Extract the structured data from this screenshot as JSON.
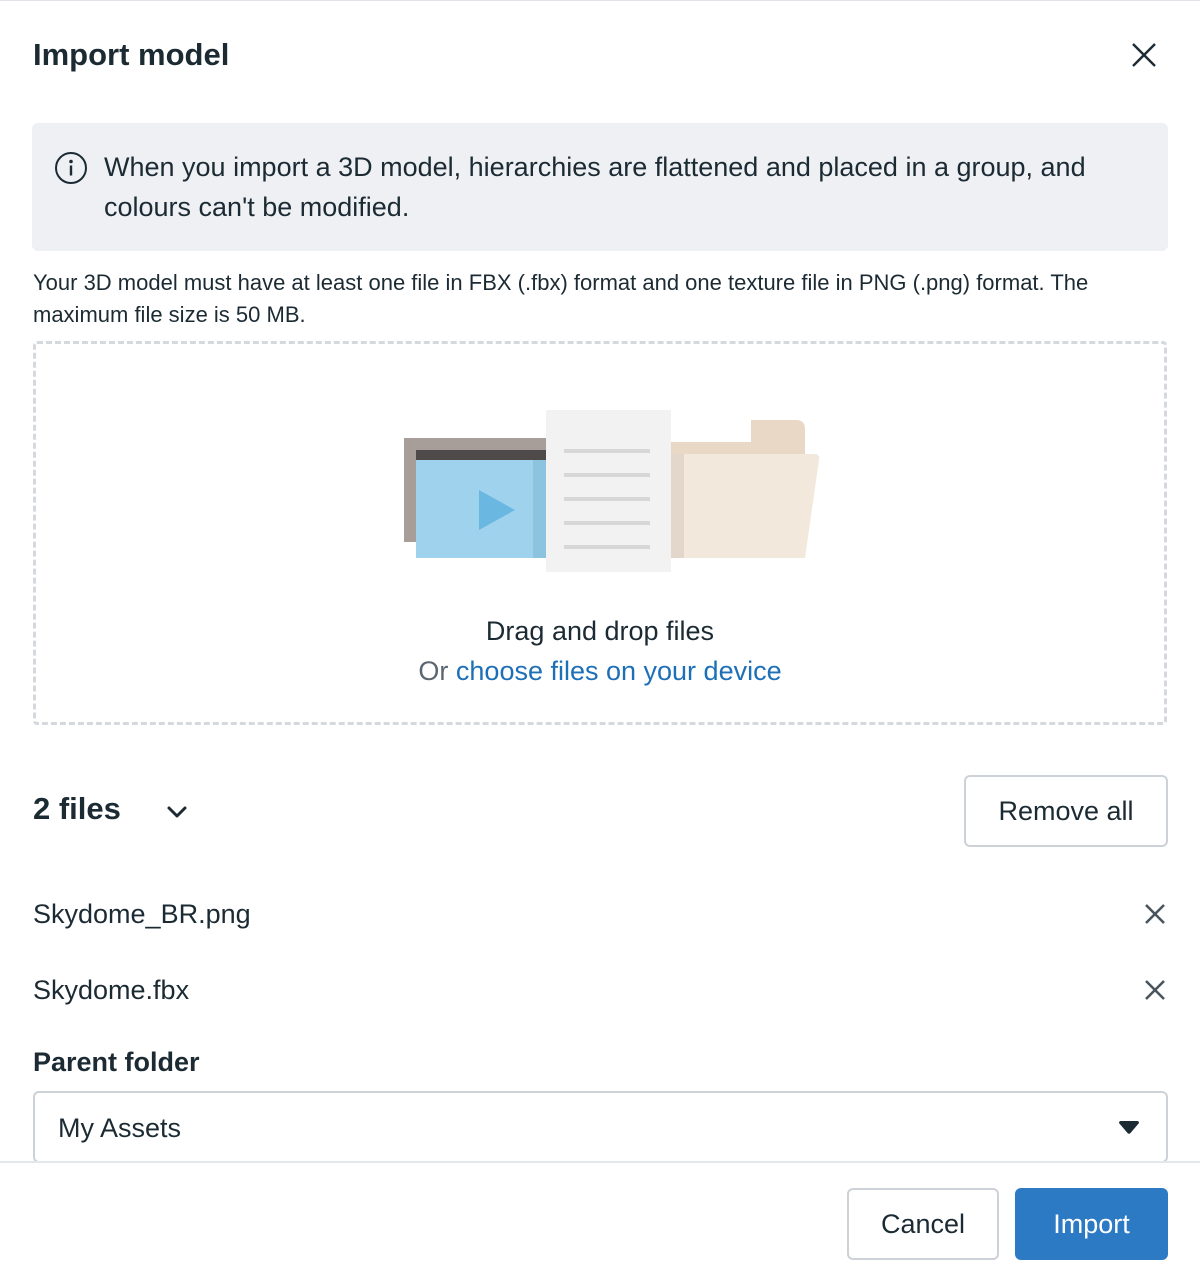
{
  "dialog": {
    "title": "Import model",
    "close_icon": "close-icon"
  },
  "info": {
    "icon": "info-icon",
    "text": "When you import a 3D model, hierarchies are flattened and placed in a group, and colours can't be modified."
  },
  "requirements": "Your 3D model must have at least one file in FBX (.fbx) format and one texture file in PNG (.png) format. The maximum file size is 50 MB.",
  "dropzone": {
    "illustration": "files-illustration",
    "title": "Drag and drop files",
    "prefix": "Or ",
    "link": "choose files on your device"
  },
  "files": {
    "header": "2 files",
    "toggle_icon": "chevron-down-icon",
    "remove_all_label": "Remove all",
    "items": [
      {
        "name": "Skydome_BR.png",
        "remove_icon": "close-icon"
      },
      {
        "name": "Skydome.fbx",
        "remove_icon": "close-icon"
      }
    ]
  },
  "parent_folder": {
    "label": "Parent folder",
    "value": "My Assets",
    "caret_icon": "caret-down-icon"
  },
  "footer": {
    "cancel_label": "Cancel",
    "import_label": "Import"
  },
  "colors": {
    "primary": "#2d7ac4",
    "link": "#1d6fb8",
    "info_bg": "#eef0f4",
    "text": "#1c2b33"
  }
}
